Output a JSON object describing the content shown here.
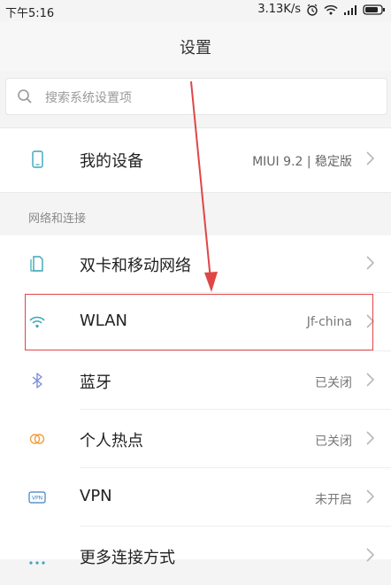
{
  "status_bar": {
    "time": "下午5:16",
    "net_speed": "3.13K/s",
    "icons": [
      "alarm-icon",
      "wifi-icon",
      "signal-icon",
      "battery-icon"
    ]
  },
  "header": {
    "title": "设置"
  },
  "search": {
    "placeholder": "搜索系统设置项"
  },
  "device": {
    "label": "我的设备",
    "value": "MIUI 9.2 | 稳定版"
  },
  "section": {
    "label": "网络和连接"
  },
  "items": [
    {
      "label": "双卡和移动网络",
      "value": "",
      "icon": "sim-card-icon"
    },
    {
      "label": "WLAN",
      "value": "Jf-china",
      "icon": "wifi-icon"
    },
    {
      "label": "蓝牙",
      "value": "已关闭",
      "icon": "bluetooth-icon"
    },
    {
      "label": "个人热点",
      "value": "已关闭",
      "icon": "hotspot-icon"
    },
    {
      "label": "VPN",
      "value": "未开启",
      "icon": "vpn-icon"
    },
    {
      "label": "更多连接方式",
      "value": "",
      "icon": "more-icon"
    }
  ],
  "colors": {
    "accent": "#3aa6b9",
    "annotation_red": "#e04646",
    "text_primary": "#222222",
    "text_secondary": "#777777"
  }
}
